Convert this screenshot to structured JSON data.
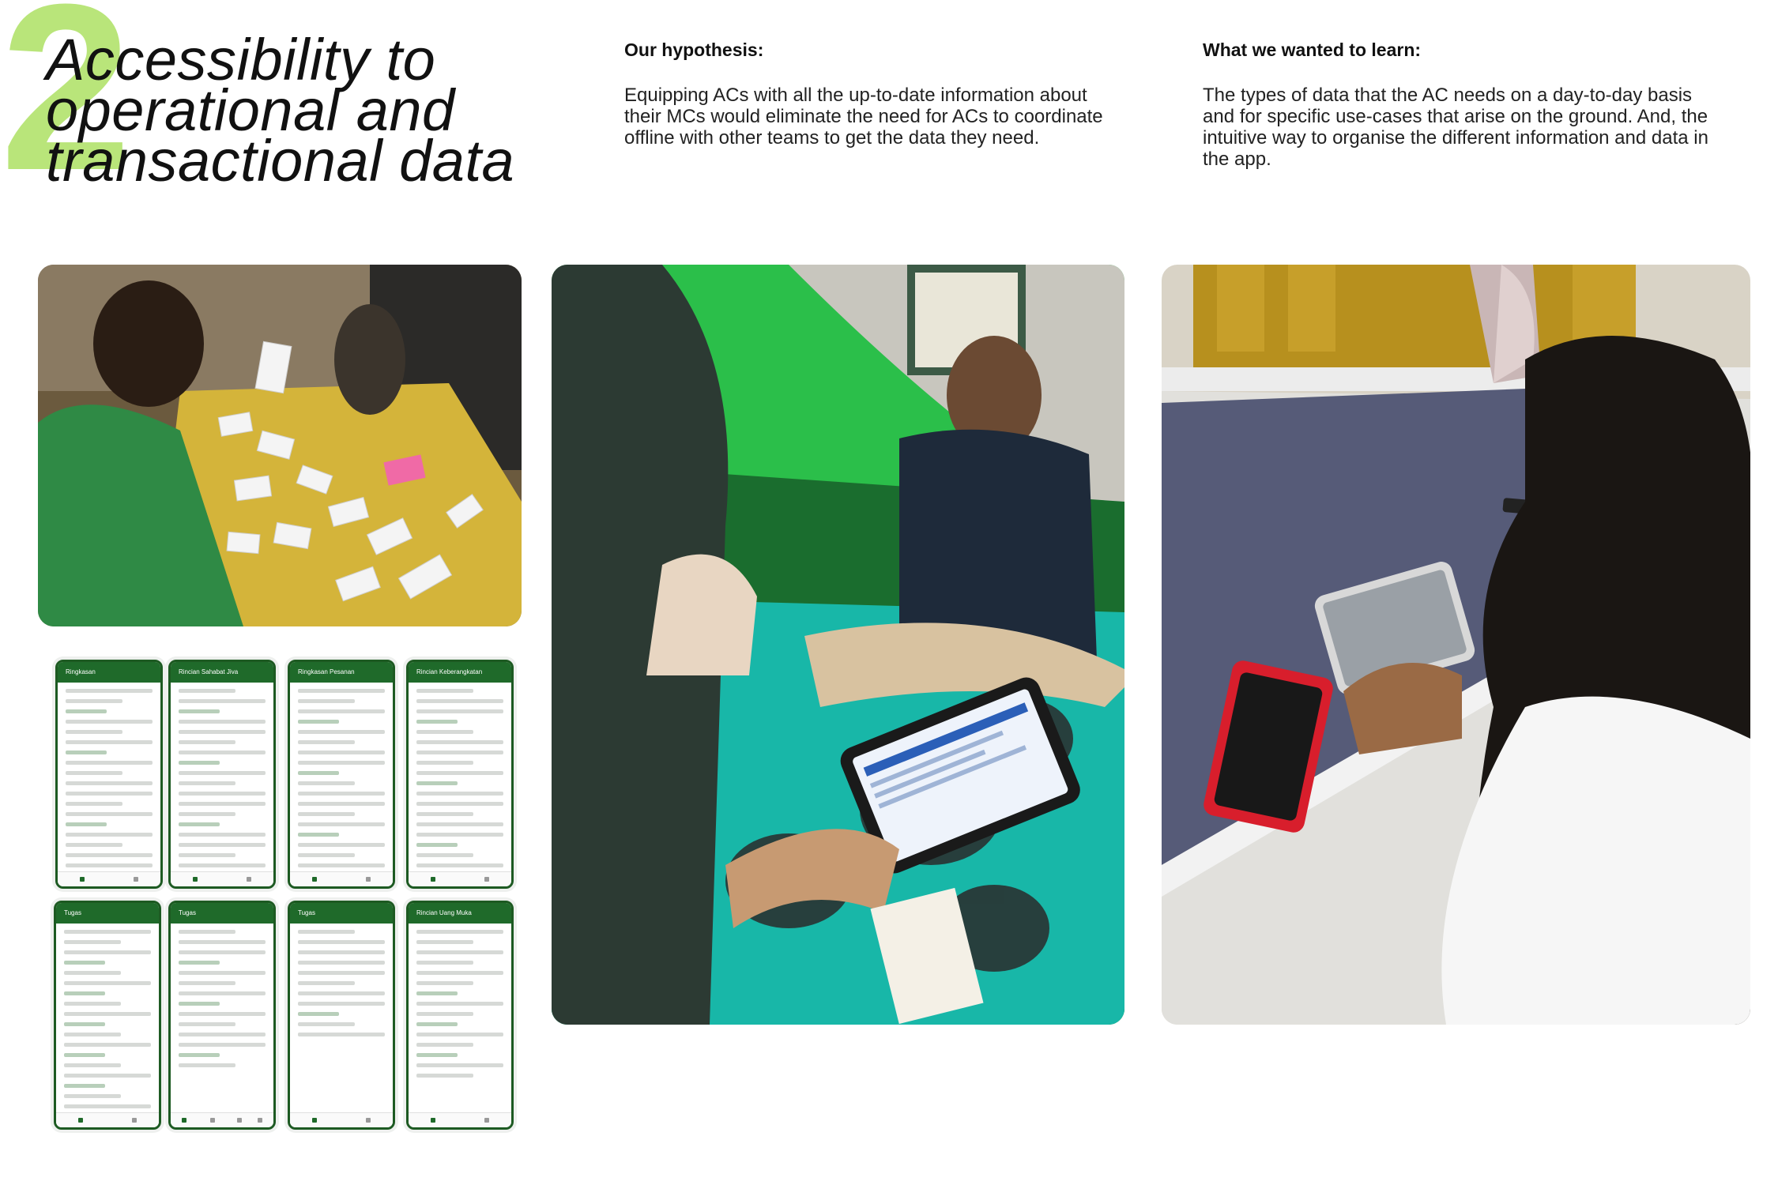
{
  "section": {
    "number": "2",
    "title_lines": [
      "Accessibility to",
      "operational and",
      "transactional data"
    ]
  },
  "hypothesis": {
    "heading": "Our hypothesis:",
    "body": "Equipping ACs with all the up-to-date information about their MCs would eliminate the need for ACs to coordinate offline with other teams to get the data they need."
  },
  "learn": {
    "heading": "What we wanted to learn:",
    "body": "The types of data that the AC needs on a day-to-day basis and for specific use-cases that arise on the ground. And, the intuitive way to organise the different information and data in the app."
  },
  "phone_screens": [
    {
      "title": "Ringkasan"
    },
    {
      "title": "Rincian Sahabat Jiva"
    },
    {
      "title": "Ringkasan Pesanan"
    },
    {
      "title": "Rincian Keberangkatan"
    },
    {
      "title": "Tugas"
    },
    {
      "title": "Tugas"
    },
    {
      "title": "Tugas"
    },
    {
      "title": "Rincian Uang Muka"
    }
  ],
  "photos": {
    "workshop": "card-sorting workshop photo",
    "mosque_session": "field testing session photo",
    "table_session": "tablet testing session photo"
  },
  "colors": {
    "accent_green": "#b9e57a",
    "app_green": "#1f6a2a"
  }
}
